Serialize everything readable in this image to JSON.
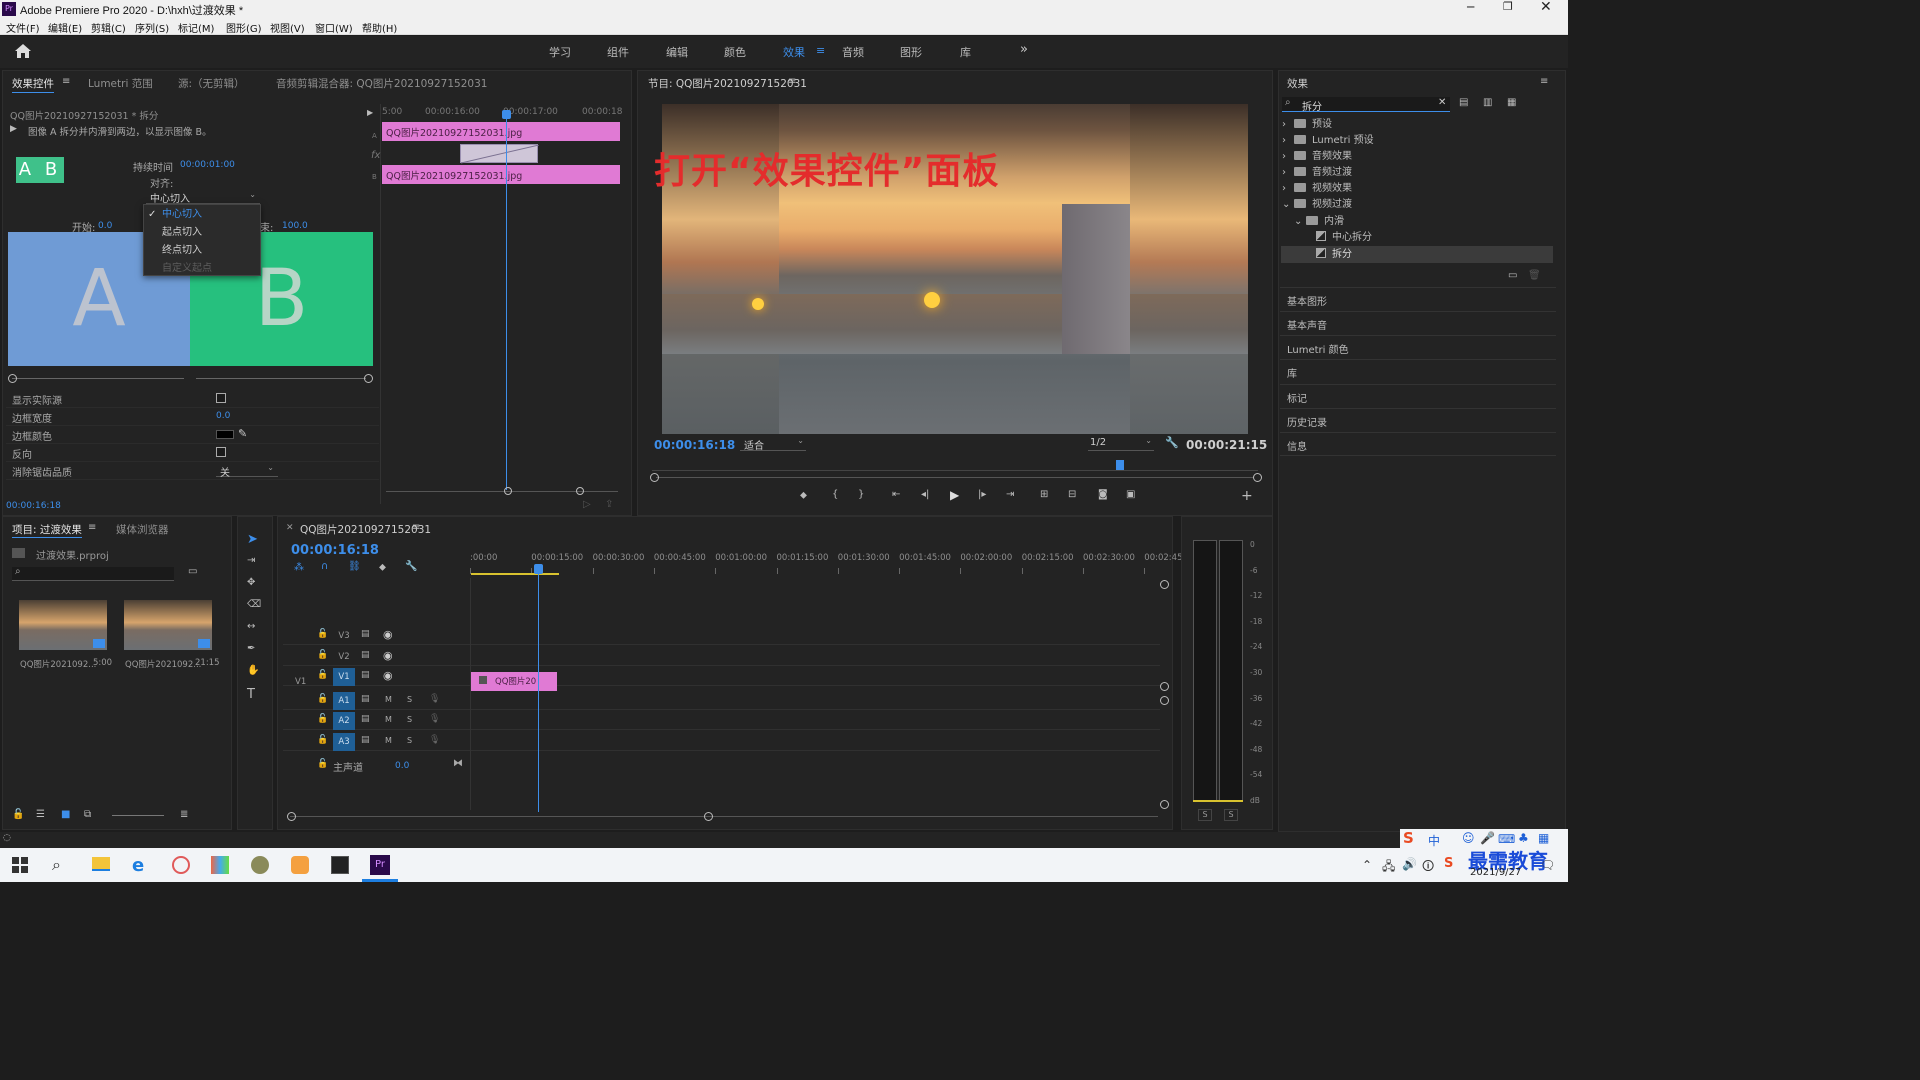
{
  "titlebar": {
    "title": "Adobe Premiere Pro 2020 - D:\\hxh\\过渡效果 *",
    "app_icon": "Pr"
  },
  "menu": [
    "文件(F)",
    "编辑(E)",
    "剪辑(C)",
    "序列(S)",
    "标记(M)",
    "图形(G)",
    "视图(V)",
    "窗口(W)",
    "帮助(H)"
  ],
  "workspaces": [
    "学习",
    "组件",
    "编辑",
    "颜色",
    "效果",
    "音频",
    "图形",
    "库"
  ],
  "workspace_active": "效果",
  "effect_controls": {
    "tabs": [
      "效果控件",
      "Lumetri 范围",
      "源:（无剪辑）",
      "音频剪辑混合器: QQ图片20210927152031"
    ],
    "clip": "QQ图片20210927152031 * 拆分",
    "description": "图像 A 拆分并内滑到两边，以显示图像 B。",
    "thumb_label": "A B",
    "duration_label": "持续时间",
    "duration": "00:00:01:00",
    "align_label": "对齐:",
    "align_value": "中心切入",
    "dropdown": [
      "中心切入",
      "起点切入",
      "终点切入",
      "自定义起点"
    ],
    "start_label": "开始:",
    "start_value": "0.0",
    "end_label": "结束:",
    "end_value": "100.0",
    "image_a": "A",
    "image_b": "B",
    "props": [
      {
        "label": "显示实际源",
        "type": "checkbox"
      },
      {
        "label": "边框宽度",
        "value": "0.0"
      },
      {
        "label": "边框颜色",
        "type": "color"
      },
      {
        "label": "反向",
        "type": "checkbox"
      },
      {
        "label": "消除锯齿品质",
        "value": "关"
      }
    ],
    "timecode": "00:00:16:18",
    "ruler": [
      "5:00",
      "00:00:16:00",
      "00:00:17:00",
      "00:00:18"
    ],
    "track_a": "A",
    "track_b": "B",
    "fx": "fx",
    "clip_a": "QQ图片20210927152031.jpg",
    "clip_b": "QQ图片20210927152031.jpg"
  },
  "program": {
    "title": "节目: QQ图片20210927152031",
    "overlay": "打开“效果控件”面板",
    "timecode": "00:00:16:18",
    "fit": "适合",
    "quality": "1/2",
    "duration": "00:00:21:15"
  },
  "effects": {
    "title": "效果",
    "search": "拆分",
    "tree": [
      {
        "label": "预设",
        "level": 0
      },
      {
        "label": "Lumetri 预设",
        "level": 0
      },
      {
        "label": "音频效果",
        "level": 0
      },
      {
        "label": "音频过渡",
        "level": 0
      },
      {
        "label": "视频效果",
        "level": 0
      },
      {
        "label": "视频过渡",
        "level": 0,
        "open": true
      },
      {
        "label": "内滑",
        "level": 1,
        "open": true
      },
      {
        "label": "中心拆分",
        "level": 2
      },
      {
        "label": "拆分",
        "level": 2,
        "selected": true
      }
    ],
    "sections": [
      "基本图形",
      "基本声音",
      "Lumetri 颜色",
      "库",
      "标记",
      "历史记录",
      "信息"
    ]
  },
  "project": {
    "tabs": [
      "项目: 过渡效果",
      "媒体浏览器"
    ],
    "file": "过渡效果.prproj",
    "items": [
      {
        "name": "QQ图片2021092...",
        "dur": "5:00"
      },
      {
        "name": "QQ图片2021092...",
        "dur": "21:15"
      }
    ]
  },
  "timeline": {
    "tab": "QQ图片20210927152031",
    "timecode": "00:00:16:18",
    "ruler": [
      ":00:00",
      "00:00:15:00",
      "00:00:30:00",
      "00:00:45:00",
      "00:01:00:00",
      "00:01:15:00",
      "00:01:30:00",
      "00:01:45:00",
      "00:02:00:00",
      "00:02:15:00",
      "00:02:30:00",
      "00:02:45:"
    ],
    "video_tracks": [
      "V3",
      "V2",
      "V1"
    ],
    "audio_tracks": [
      "A1",
      "A2",
      "A3"
    ],
    "src_v1": "V1",
    "master_label": "主声道",
    "master_value": "0.0",
    "m": "M",
    "s": "S",
    "clip": "QQ图片20"
  },
  "meter": {
    "scale": [
      "0",
      "-6",
      "-12",
      "-18",
      "-24",
      "-30",
      "-36",
      "-42",
      "-48",
      "-54",
      "dB"
    ],
    "solo": [
      "S",
      "S"
    ]
  },
  "taskbar": {
    "ime": "中",
    "clock_date": "2021/9/27",
    "watermark": "最需教育"
  }
}
